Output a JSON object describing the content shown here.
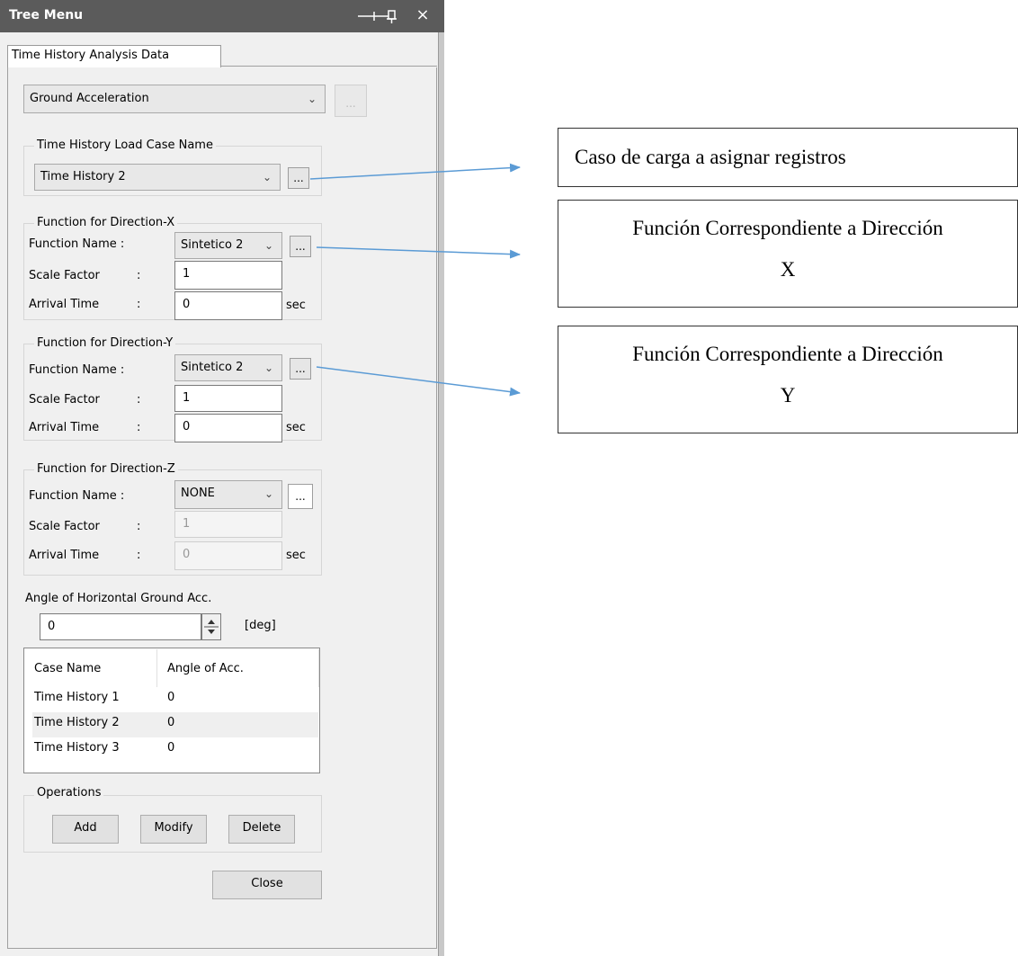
{
  "window": {
    "title": "Tree Menu",
    "close_glyph": "×",
    "pin_icon": "pin-icon"
  },
  "tab": {
    "label": "Time History Analysis Data"
  },
  "data_type": {
    "value": "Ground Acceleration",
    "more": "..."
  },
  "load_case": {
    "group_title": "Time History Load Case Name",
    "value": "Time History 2",
    "more": "..."
  },
  "dir_x": {
    "group_title": "Function for Direction-X",
    "function_label": "Function Name :",
    "function_value": "Sintetico 2",
    "scale_label": "Scale Factor",
    "scale_value": "1",
    "arrival_label": "Arrival Time",
    "arrival_value": "0",
    "unit": "sec",
    "colon": ":"
  },
  "dir_y": {
    "group_title": "Function for Direction-Y",
    "function_label": "Function Name :",
    "function_value": "Sintetico 2",
    "scale_label": "Scale Factor",
    "scale_value": "1",
    "arrival_label": "Arrival Time",
    "arrival_value": "0",
    "unit": "sec",
    "colon": ":"
  },
  "dir_z": {
    "group_title": "Function for Direction-Z",
    "function_label": "Function Name :",
    "function_value": "NONE",
    "scale_label": "Scale Factor",
    "scale_value": "1",
    "arrival_label": "Arrival Time",
    "arrival_value": "0",
    "unit": "sec",
    "colon": ":"
  },
  "angle": {
    "label": "Angle of Horizontal Ground Acc.",
    "value": "0",
    "unit": "[deg]"
  },
  "case_table": {
    "headers": [
      "Case Name",
      "Angle of Acc."
    ],
    "rows": [
      [
        "Time History 1",
        "0"
      ],
      [
        "Time History 2",
        "0"
      ],
      [
        "Time History 3",
        "0"
      ]
    ],
    "selected_index": 1
  },
  "operations": {
    "group_title": "Operations",
    "add": "Add",
    "modify": "Modify",
    "delete": "Delete"
  },
  "close_button": "Close",
  "annotations": {
    "load_case_note": "Caso de carga a asignar registros",
    "x_note_line1": "Función Correspondiente a Dirección",
    "x_note_line2": "X",
    "y_note_line1": "Función Correspondiente a Dirección",
    "y_note_line2": "Y"
  },
  "colors": {
    "titlebar": "#5b5b5b",
    "arrow": "#5b9bd5",
    "selected_row": "#efefef"
  }
}
